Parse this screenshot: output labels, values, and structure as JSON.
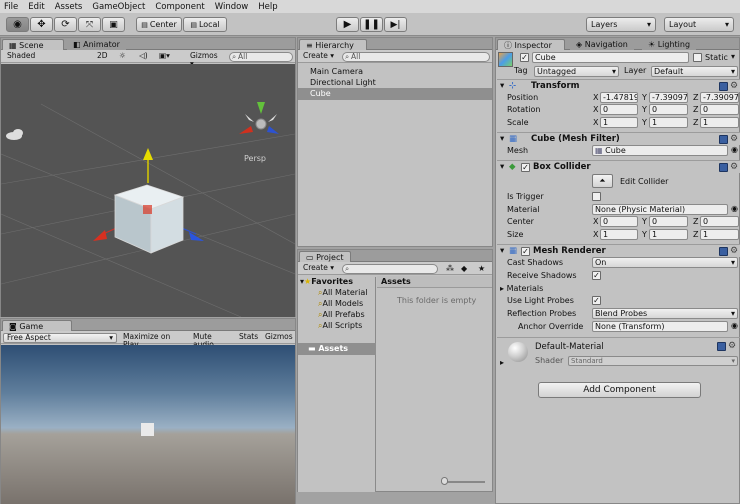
{
  "menu": [
    "File",
    "Edit",
    "Assets",
    "GameObject",
    "Component",
    "Window",
    "Help"
  ],
  "toolbar": {
    "center_label": "Center",
    "local_label": "Local",
    "layers_label": "Layers",
    "layout_label": "Layout"
  },
  "scene": {
    "tab_label": "Scene",
    "animator_tab": "Animator",
    "shading": "Shaded",
    "mode_2d": "2D",
    "gizmos": "Gizmos",
    "search_placeholder": "All",
    "persp": "Persp"
  },
  "game": {
    "tab_label": "Game",
    "aspect": "Free Aspect",
    "maximize": "Maximize on Play",
    "mute": "Mute audio",
    "stats": "Stats",
    "gizmos": "Gizmos"
  },
  "hierarchy": {
    "tab_label": "Hierarchy",
    "create": "Create",
    "search_placeholder": "All",
    "items": [
      "Main Camera",
      "Directional Light",
      "Cube"
    ]
  },
  "project": {
    "tab_label": "Project",
    "create": "Create",
    "favorites": "Favorites",
    "favorite_items": [
      "All Material",
      "All Models",
      "All Prefabs",
      "All Scripts"
    ],
    "assets_folder": "Assets",
    "assets_header": "Assets",
    "empty_message": "This folder is empty"
  },
  "inspector": {
    "tabs": [
      "Inspector",
      "Navigation",
      "Lighting"
    ],
    "object_name": "Cube",
    "static_label": "Static",
    "tag_label": "Tag",
    "tag_value": "Untagged",
    "layer_label": "Layer",
    "layer_value": "Default",
    "transform": {
      "title": "Transform",
      "position": {
        "label": "Position",
        "x": "-1.47819",
        "y": "-7.39097",
        "z": "-7.39097"
      },
      "rotation": {
        "label": "Rotation",
        "x": "0",
        "y": "0",
        "z": "0"
      },
      "scale": {
        "label": "Scale",
        "x": "1",
        "y": "1",
        "z": "1"
      }
    },
    "mesh_filter": {
      "title": "Cube (Mesh Filter)",
      "mesh_label": "Mesh",
      "mesh_value": "Cube"
    },
    "box_collider": {
      "title": "Box Collider",
      "edit": "Edit Collider",
      "is_trigger": "Is Trigger",
      "material_label": "Material",
      "material_value": "None (Physic Material)",
      "center": {
        "label": "Center",
        "x": "0",
        "y": "0",
        "z": "0"
      },
      "size": {
        "label": "Size",
        "x": "1",
        "y": "1",
        "z": "1"
      }
    },
    "mesh_renderer": {
      "title": "Mesh Renderer",
      "cast_shadows": "Cast Shadows",
      "cast_value": "On",
      "receive_shadows": "Receive Shadows",
      "materials": "Materials",
      "light_probes": "Use Light Probes",
      "reflection_probes": "Reflection Probes",
      "reflection_value": "Blend Probes",
      "anchor": "Anchor Override",
      "anchor_value": "None (Transform)"
    },
    "material": {
      "name": "Default-Material",
      "shader_label": "Shader",
      "shader_value": "Standard"
    },
    "add_component": "Add Component"
  },
  "axis_labels": {
    "x": "X",
    "y": "Y",
    "z": "Z"
  }
}
